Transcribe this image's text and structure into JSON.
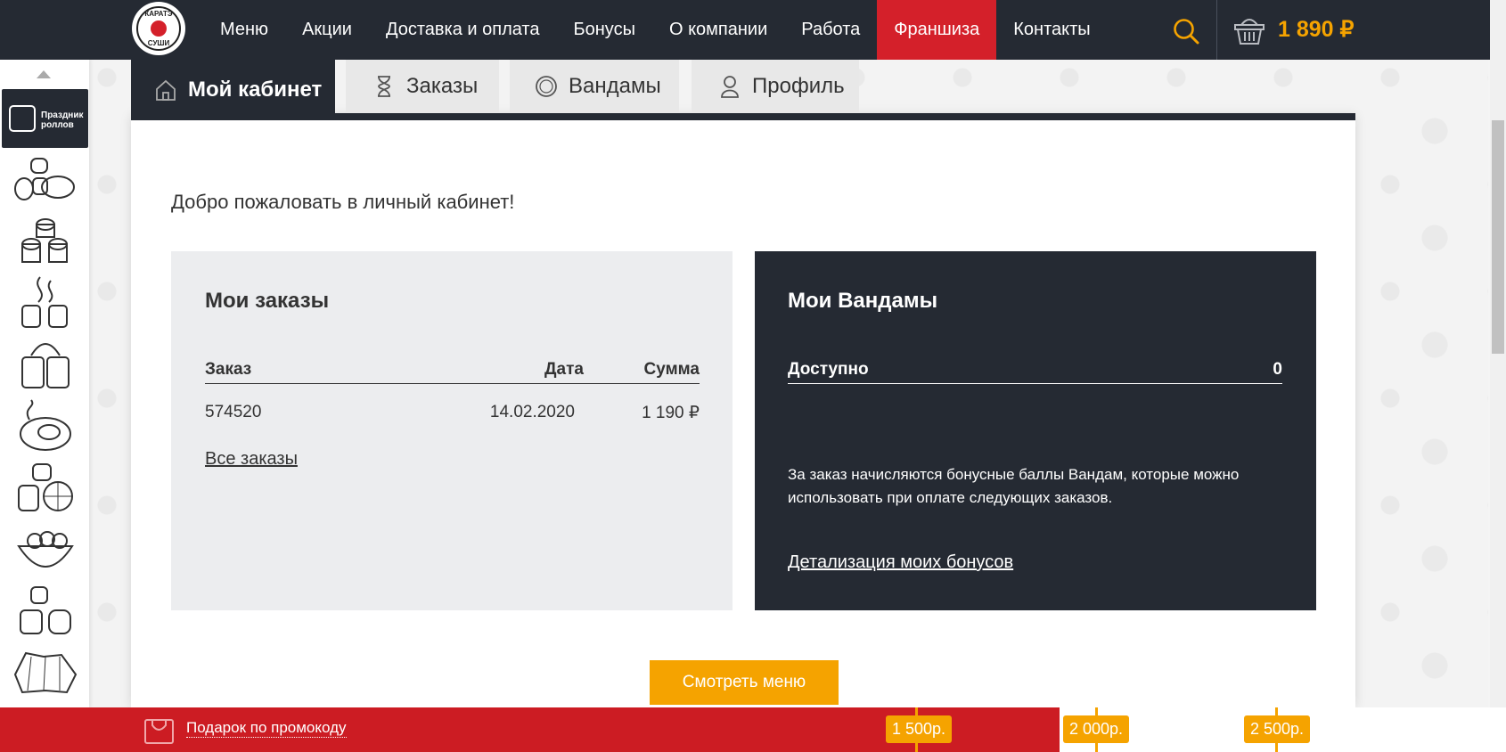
{
  "header": {
    "logo_text_top": "КАРАТЭ",
    "logo_text_bottom": "СУШИ",
    "nav": [
      "Меню",
      "Акции",
      "Доставка и оплата",
      "Бонусы",
      "О компании",
      "Работа",
      "Франшиза",
      "Контакты"
    ],
    "active_nav_index": 6,
    "cart_total": "1 890 ₽"
  },
  "sidebar": {
    "promo_label": "Праздник роллов",
    "categories": [
      "sushi-rolls",
      "rolls",
      "hot-rolls",
      "baked-rolls",
      "grilled-roll",
      "citrus-rolls",
      "noodle-bowl",
      "mini-rolls",
      "tempura-rolls"
    ]
  },
  "tabs": [
    {
      "label": "Мой кабинет",
      "icon": "home-icon",
      "active": true
    },
    {
      "label": "Заказы",
      "icon": "hourglass-icon",
      "active": false
    },
    {
      "label": "Вандамы",
      "icon": "coin-icon",
      "active": false
    },
    {
      "label": "Профиль",
      "icon": "user-icon",
      "active": false
    }
  ],
  "welcome": "Добро пожаловать в личный кабинет!",
  "orders": {
    "title": "Мои заказы",
    "columns": {
      "order": "Заказ",
      "date": "Дата",
      "sum": "Сумма"
    },
    "rows": [
      {
        "order": "574520",
        "date": "14.02.2020",
        "sum": "1 190 ₽"
      }
    ],
    "all_link": "Все заказы"
  },
  "bonuses": {
    "title": "Мои Вандамы",
    "available_label": "Доступно",
    "available_value": "0",
    "description": "За заказ начисляются бонусные баллы Вандам, которые можно использовать при оплате следующих заказов.",
    "detail_link": "Детализация моих бонусов"
  },
  "menu_button": "Смотреть меню",
  "promo_bar": {
    "promo_link": "Подарок по промокоду",
    "thresholds": [
      "1 500р.",
      "2 000р.",
      "2 500р."
    ],
    "progress_color": "#cc1c23",
    "accent": "#f5a300"
  }
}
